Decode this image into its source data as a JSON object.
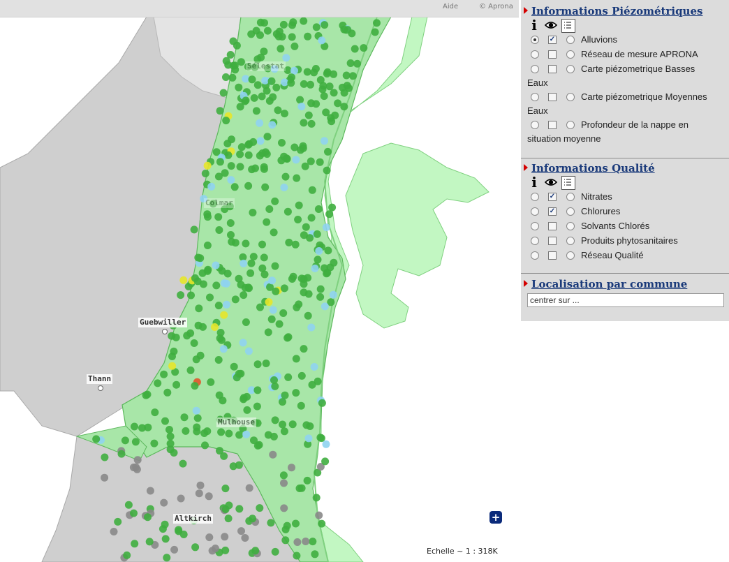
{
  "topbar": {
    "help": "Aide",
    "copyright": "© Aprona"
  },
  "map": {
    "towns": [
      "Guebwiller",
      "Thann",
      "Mulhouse",
      "Altkirch",
      "Colmar",
      "Sélestat"
    ],
    "scale_text": "Echelle ~ 1 : 318K",
    "zoom_in_icon": "plus-icon",
    "colors": {
      "background": "#cfcfcf",
      "alluvium": "#a8e6a8",
      "germany": "#c2f7c2",
      "point_good": "#3fae3f",
      "point_warn": "#e5e52a",
      "point_bad": "#e0552a",
      "point_blue": "#8fd3ef",
      "point_grey": "#888888"
    }
  },
  "piezo": {
    "title": "Informations Piézométriques",
    "items": [
      {
        "label": "Alluvions",
        "label2": "",
        "selected": true,
        "checked": true
      },
      {
        "label": "Réseau de mesure APRONA",
        "label2": "",
        "selected": false,
        "checked": false
      },
      {
        "label": "Carte piézometrique Basses",
        "label2": "Eaux",
        "selected": false,
        "checked": false
      },
      {
        "label": "Carte piézometrique Moyennes",
        "label2": "Eaux",
        "selected": false,
        "checked": false
      },
      {
        "label": "Profondeur de la nappe en",
        "label2": "situation moyenne",
        "selected": false,
        "checked": false
      }
    ]
  },
  "qualite": {
    "title": "Informations Qualité",
    "items": [
      {
        "label": "Nitrates",
        "checked": true
      },
      {
        "label": "Chlorures",
        "checked": true
      },
      {
        "label": "Solvants Chlorés",
        "checked": false
      },
      {
        "label": "Produits phytosanitaires",
        "checked": false
      },
      {
        "label": "Réseau Qualité",
        "checked": false
      }
    ]
  },
  "localisation": {
    "title": "Localisation par commune",
    "input_value": "centrer sur ..."
  }
}
